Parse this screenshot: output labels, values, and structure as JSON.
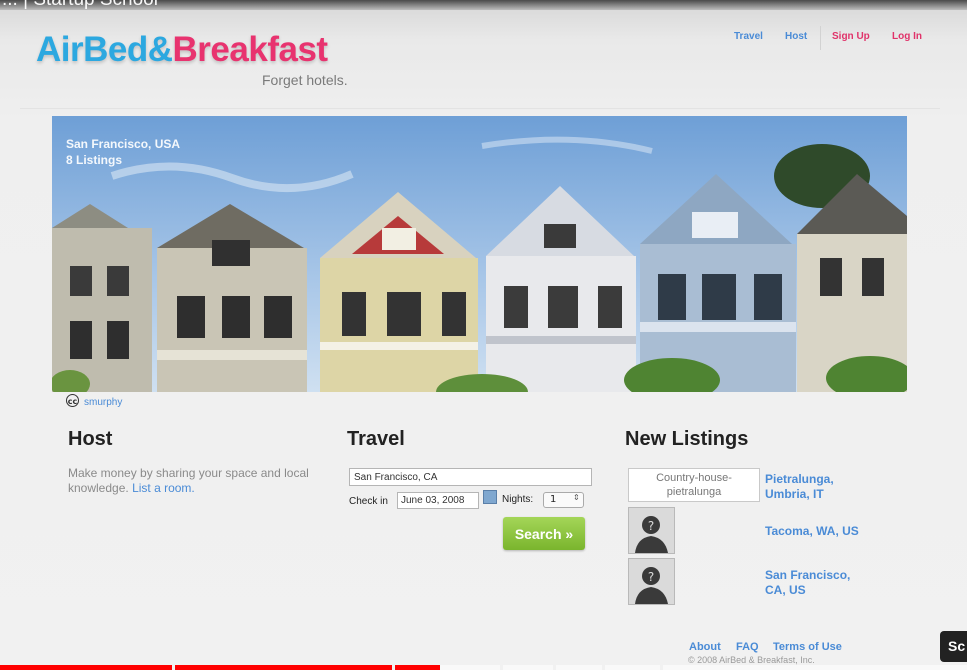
{
  "video": {
    "title_fragment": "... | Startup School",
    "overlay_button_label": "Sc",
    "progress_fraction": 0.455
  },
  "header": {
    "logo_part_1": "AirBed&",
    "logo_part_2": "Breakfast",
    "tagline": "Forget hotels.",
    "nav": {
      "travel": "Travel",
      "host": "Host",
      "sign_up": "Sign Up",
      "log_in": "Log In"
    }
  },
  "hero": {
    "location": "San Francisco, USA",
    "listing_count": "8 Listings",
    "photo_credit_icon": "cc",
    "photo_credit": "smurphy"
  },
  "host": {
    "heading": "Host",
    "description": "Make money by sharing your space and local knowledge.",
    "link": "List a room."
  },
  "travel": {
    "heading": "Travel",
    "location_value": "San Francisco, CA",
    "checkin_label": "Check in",
    "checkin_value": "June 03, 2008",
    "nights_label": "Nights:",
    "nights_value": "1",
    "search_button": "Search »"
  },
  "new_listings": {
    "heading": "New Listings",
    "items": [
      {
        "thumb_alt": "Country-house-pietralunga",
        "name": "Pietralunga, Umbria, IT"
      },
      {
        "thumb_alt": "",
        "name": "Tacoma, WA, US"
      },
      {
        "thumb_alt": "",
        "name": "San Francisco, CA, US"
      }
    ]
  },
  "footer": {
    "about": "About",
    "faq": "FAQ",
    "terms": "Terms of Use",
    "copyright": "© 2008 AirBed & Breakfast, Inc."
  },
  "colors": {
    "brand_blue": "#2ca8e0",
    "brand_pink": "#e8336f",
    "link_blue": "#4a8bd6",
    "search_green": "#8cc63f",
    "progress_red": "#ff0000"
  }
}
